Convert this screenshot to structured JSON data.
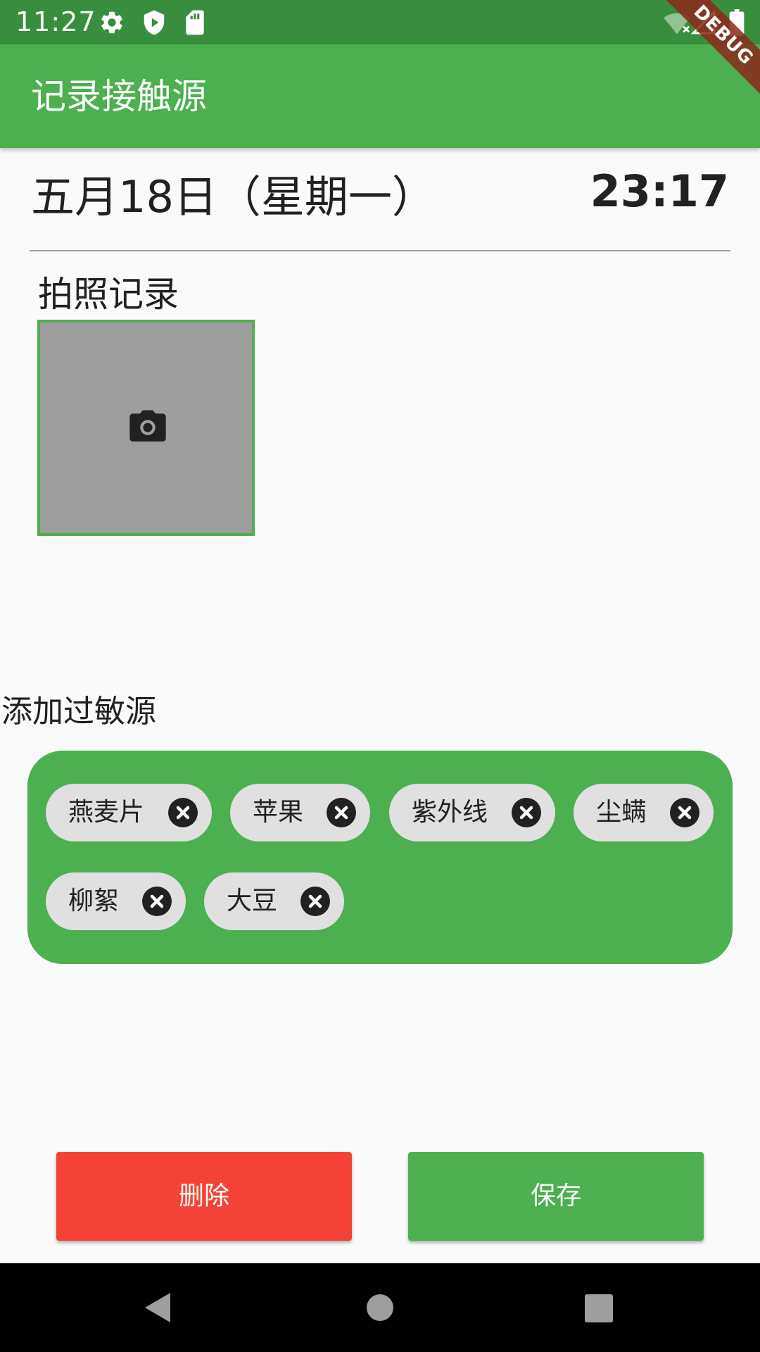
{
  "status_bar": {
    "time": "11:27",
    "icons": [
      "gear-icon",
      "shield-play-icon",
      "sd-card-icon",
      "wifi-off-icon",
      "signal-icon",
      "battery-icon"
    ]
  },
  "debug_banner": "DEBUG",
  "app_bar": {
    "title": "记录接触源"
  },
  "date_row": {
    "date": "五月18日（星期一）",
    "time": "23:17"
  },
  "photo_section": {
    "label": "拍照记录",
    "placeholder_icon": "camera-icon"
  },
  "allergen_section": {
    "label": "添加过敏源",
    "chips": [
      {
        "label": "燕麦片"
      },
      {
        "label": "苹果"
      },
      {
        "label": "紫外线"
      },
      {
        "label": "尘螨"
      },
      {
        "label": "柳絮"
      },
      {
        "label": "大豆"
      }
    ]
  },
  "actions": {
    "delete_label": "删除",
    "save_label": "保存"
  },
  "colors": {
    "primary": "#4caf50",
    "primary_dark": "#388e3c",
    "delete": "#f44336",
    "chip_background": "#e0e0e0"
  }
}
